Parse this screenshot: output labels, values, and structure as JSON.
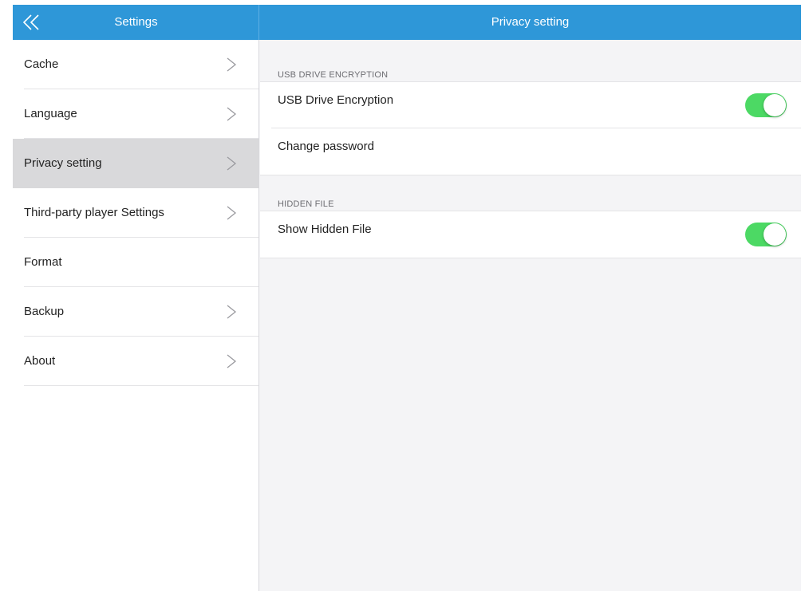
{
  "colors": {
    "header_bg": "#2e97d8",
    "toggle_on": "#4cd964",
    "selected_row": "#d9d9db"
  },
  "header": {
    "back_icon": "double-chevron-left-icon",
    "left_title": "Settings",
    "right_title": "Privacy setting"
  },
  "sidebar": {
    "items": [
      {
        "label": "Cache",
        "has_chevron": true,
        "selected": false
      },
      {
        "label": "Language",
        "has_chevron": true,
        "selected": false
      },
      {
        "label": "Privacy setting",
        "has_chevron": true,
        "selected": true
      },
      {
        "label": "Third-party player Settings",
        "has_chevron": true,
        "selected": false
      },
      {
        "label": "Format",
        "has_chevron": false,
        "selected": false
      },
      {
        "label": "Backup",
        "has_chevron": true,
        "selected": false
      },
      {
        "label": "About",
        "has_chevron": true,
        "selected": false
      }
    ]
  },
  "main": {
    "sections": [
      {
        "header": "USB DRIVE ENCRYPTION",
        "rows": [
          {
            "label": "USB Drive Encryption",
            "toggle": true,
            "toggle_on": true
          },
          {
            "label": "Change password",
            "toggle": false
          }
        ]
      },
      {
        "header": "HIDDEN FILE",
        "rows": [
          {
            "label": "Show Hidden File",
            "toggle": true,
            "toggle_on": true
          }
        ]
      }
    ]
  }
}
